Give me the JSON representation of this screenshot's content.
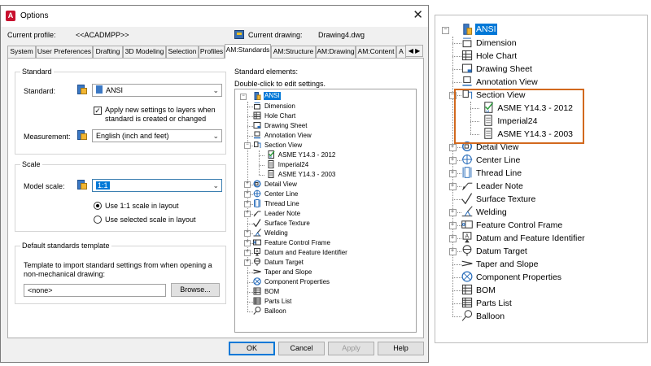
{
  "dialog": {
    "title": "Options",
    "close_symbol": "✕",
    "current_profile_label": "Current profile:",
    "current_profile_value": "<<ACADMPP>>",
    "current_drawing_label": "Current drawing:",
    "current_drawing_value": "Drawing4.dwg",
    "tabs": [
      "System",
      "User Preferences",
      "Drafting",
      "3D Modeling",
      "Selection",
      "Profiles",
      "AM:Standards",
      "AM:Structure",
      "AM:Drawing",
      "AM:Content",
      "A"
    ],
    "active_tab": "AM:Standards",
    "tab_scroll": "◀ ▶"
  },
  "standard_group": {
    "title": "Standard",
    "standard_label": "Standard:",
    "standard_value": "ANSI",
    "apply_checkbox_checked": true,
    "apply_checkbox_text_line1": "Apply new settings to layers when",
    "apply_checkbox_text_line2": "standard is created or changed",
    "measurement_label": "Measurement:",
    "measurement_value": "English (inch and feet)"
  },
  "scale_group": {
    "title": "Scale",
    "model_scale_label": "Model scale:",
    "model_scale_value": "1:1",
    "radio_use_1to1": "Use 1:1 scale in layout",
    "radio_use_selected": "Use selected scale in layout",
    "selected_radio": "use_1to1"
  },
  "template_group": {
    "title": "Default standards template",
    "description_line1": "Template to import standard settings from when opening a",
    "description_line2": "non-mechanical drawing:",
    "template_value": "<none>",
    "browse_label": "Browse..."
  },
  "standard_elements": {
    "title": "Standard elements:",
    "hint": "Double-click to edit settings."
  },
  "tree": {
    "root": "ANSI",
    "items": [
      {
        "label": "Dimension",
        "icon": "dimension-icon",
        "level": 1,
        "expander": ""
      },
      {
        "label": "Hole Chart",
        "icon": "hole-chart-icon",
        "level": 1,
        "expander": ""
      },
      {
        "label": "Drawing Sheet",
        "icon": "drawing-sheet-icon",
        "level": 1,
        "expander": ""
      },
      {
        "label": "Annotation View",
        "icon": "annotation-view-icon",
        "level": 1,
        "expander": ""
      },
      {
        "label": "Section View",
        "icon": "section-view-icon",
        "level": 1,
        "expander": "−"
      },
      {
        "label": "ASME Y14.3 - 2012",
        "icon": "check-document-icon",
        "level": 2,
        "expander": ""
      },
      {
        "label": "Imperial24",
        "icon": "document-icon",
        "level": 2,
        "expander": ""
      },
      {
        "label": "ASME Y14.3 - 2003",
        "icon": "document-icon",
        "level": 2,
        "expander": ""
      },
      {
        "label": "Detail View",
        "icon": "detail-view-icon",
        "level": 1,
        "expander": "+"
      },
      {
        "label": "Center Line",
        "icon": "center-line-icon",
        "level": 1,
        "expander": "+"
      },
      {
        "label": "Thread Line",
        "icon": "thread-line-icon",
        "level": 1,
        "expander": "+"
      },
      {
        "label": "Leader Note",
        "icon": "leader-note-icon",
        "level": 1,
        "expander": "+"
      },
      {
        "label": "Surface Texture",
        "icon": "surface-texture-icon",
        "level": 1,
        "expander": ""
      },
      {
        "label": "Welding",
        "icon": "welding-icon",
        "level": 1,
        "expander": "+"
      },
      {
        "label": "Feature Control Frame",
        "icon": "feature-control-frame-icon",
        "level": 1,
        "expander": "+"
      },
      {
        "label": "Datum and Feature Identifier",
        "icon": "datum-feature-icon",
        "level": 1,
        "expander": "+"
      },
      {
        "label": "Datum Target",
        "icon": "datum-target-icon",
        "level": 1,
        "expander": "+"
      },
      {
        "label": "Taper and Slope",
        "icon": "taper-slope-icon",
        "level": 1,
        "expander": ""
      },
      {
        "label": "Component Properties",
        "icon": "component-properties-icon",
        "level": 1,
        "expander": ""
      },
      {
        "label": "BOM",
        "icon": "bom-icon",
        "level": 1,
        "expander": ""
      },
      {
        "label": "Parts List",
        "icon": "parts-list-icon",
        "level": 1,
        "expander": ""
      },
      {
        "label": "Balloon",
        "icon": "balloon-icon",
        "level": 1,
        "expander": ""
      }
    ]
  },
  "buttons": {
    "ok": "OK",
    "cancel": "Cancel",
    "apply": "Apply",
    "help": "Help"
  },
  "colors": {
    "selection": "#0078d7",
    "callout": "#d2691e",
    "app_icon": "#c8102e"
  }
}
